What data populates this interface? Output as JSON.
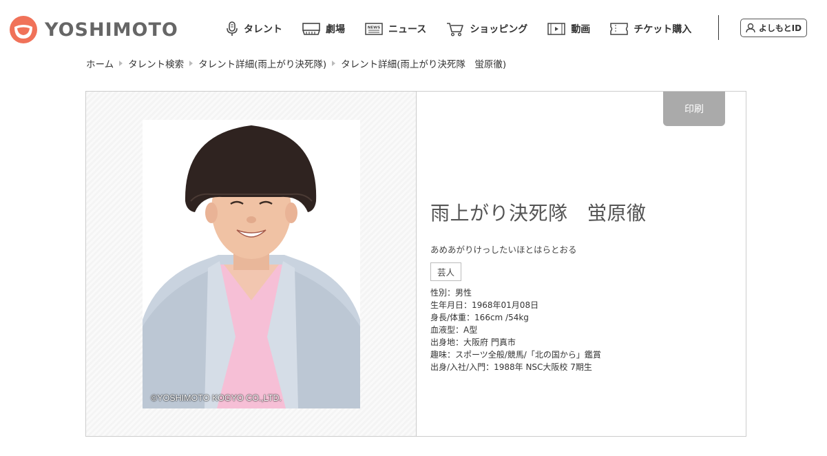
{
  "brand": {
    "name": "YOSHIMOTO",
    "color": "#f07259"
  },
  "nav": [
    {
      "label": "タレント",
      "icon": "microphone-icon"
    },
    {
      "label": "劇場",
      "icon": "theater-icon"
    },
    {
      "label": "ニュース",
      "icon": "news-icon",
      "icon_text": "NEWS"
    },
    {
      "label": "ショッピング",
      "icon": "cart-icon"
    },
    {
      "label": "動画",
      "icon": "video-icon"
    },
    {
      "label": "チケット購入",
      "icon": "ticket-icon"
    }
  ],
  "account": {
    "label": "よしもとID",
    "icon": "user-icon"
  },
  "breadcrumb": [
    "ホーム",
    "タレント検索",
    "タレント詳細(雨上がり決死隊)",
    "タレント詳細(雨上がり決死隊　蛍原徹)"
  ],
  "profile": {
    "print_label": "印刷",
    "name": "雨上がり決死隊　蛍原徹",
    "kana": "あめあがりけっしたいほとはらとおる",
    "category": "芸人",
    "copyright": "©YOSHIMOTO KOGYO CO.,LTD.",
    "details": [
      "性別：男性",
      "生年月日：1968年01月08日",
      "身長/体重：166cm /54kg",
      "血液型：A型",
      "出身地：大阪府 門真市",
      "趣味：スポーツ全般/競馬/「北の国から」鑑賞",
      "出身/入社/入門：1988年 NSC大阪校 7期生"
    ]
  }
}
